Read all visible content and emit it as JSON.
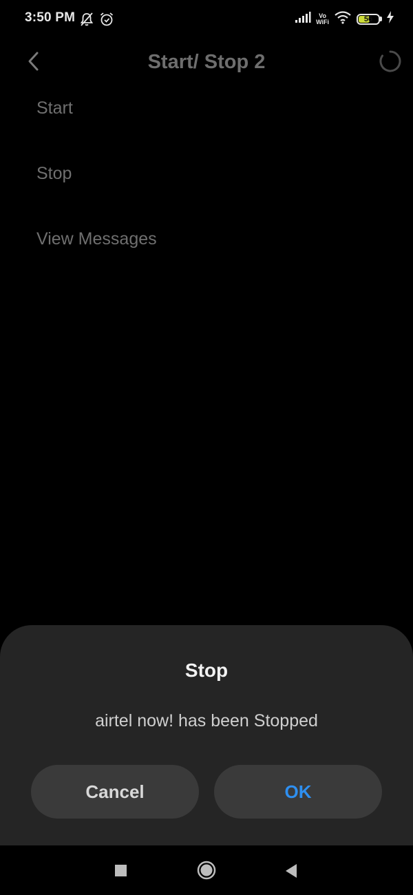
{
  "status_bar": {
    "time": "3:50 PM",
    "left_icons": [
      "bell-off-icon",
      "alarm-icon"
    ],
    "right_icons": [
      "signal-icon",
      "vowifi-icon",
      "wifi-icon",
      "battery-icon",
      "charging-icon"
    ],
    "vowifi_top": "Vo",
    "vowifi_bottom": "WiFi",
    "battery_level": "56",
    "battery_fraction": 0.56
  },
  "app_bar": {
    "title": "Start/ Stop 2",
    "back_icon": "chevron-left-icon",
    "refresh_icon": "loading-spinner-icon"
  },
  "menu": {
    "items": [
      {
        "label": "Start"
      },
      {
        "label": "Stop"
      },
      {
        "label": "View Messages"
      }
    ]
  },
  "dialog": {
    "title": "Stop",
    "message": "airtel now! has been Stopped",
    "cancel_label": "Cancel",
    "ok_label": "OK"
  },
  "nav_bar": {
    "icons": [
      "recents-square-icon",
      "home-circle-icon",
      "back-triangle-icon"
    ]
  },
  "colors": {
    "background": "#000000",
    "dialog_background": "#252525",
    "button_background": "#3a3a3a",
    "accent": "#2e8ff0",
    "battery_fill": "#cddc39"
  }
}
